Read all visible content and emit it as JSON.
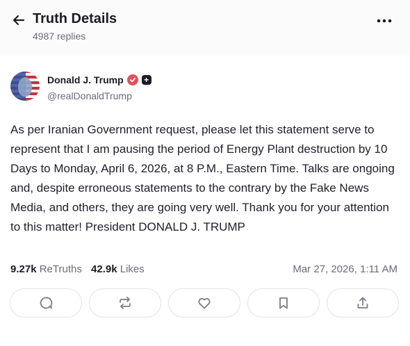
{
  "header": {
    "title": "Truth Details",
    "replies": "4987 replies"
  },
  "post": {
    "author_name": "Donald J. Trump",
    "handle": "@realDonaldTrump",
    "text": "As per Iranian Government request, please let this statement serve to represent that I am pausing the period of Energy Plant destruction by 10 Days to Monday, April 6, 2026, at 8 P.M., Eastern Time. Talks are ongoing and, despite erroneous statements to the contrary by the Fake News Media, and others, they are going very well. Thank you for your attention to this matter! President DONALD J. TRUMP",
    "retruths_count": "9.27k",
    "retruths_label": "ReTruths",
    "likes_count": "42.9k",
    "likes_label": "Likes",
    "timestamp": "Mar 27, 2026, 1:11 AM"
  },
  "badges": {
    "plus": "+"
  },
  "actions": [
    {
      "name": "reply",
      "icon": "comment-icon"
    },
    {
      "name": "retruth",
      "icon": "repost-icon"
    },
    {
      "name": "like",
      "icon": "heart-icon"
    },
    {
      "name": "bookmark",
      "icon": "bookmark-icon"
    },
    {
      "name": "share",
      "icon": "share-icon"
    }
  ],
  "colors": {
    "verified": "#e4505b",
    "icon": "#7b7b8c"
  }
}
